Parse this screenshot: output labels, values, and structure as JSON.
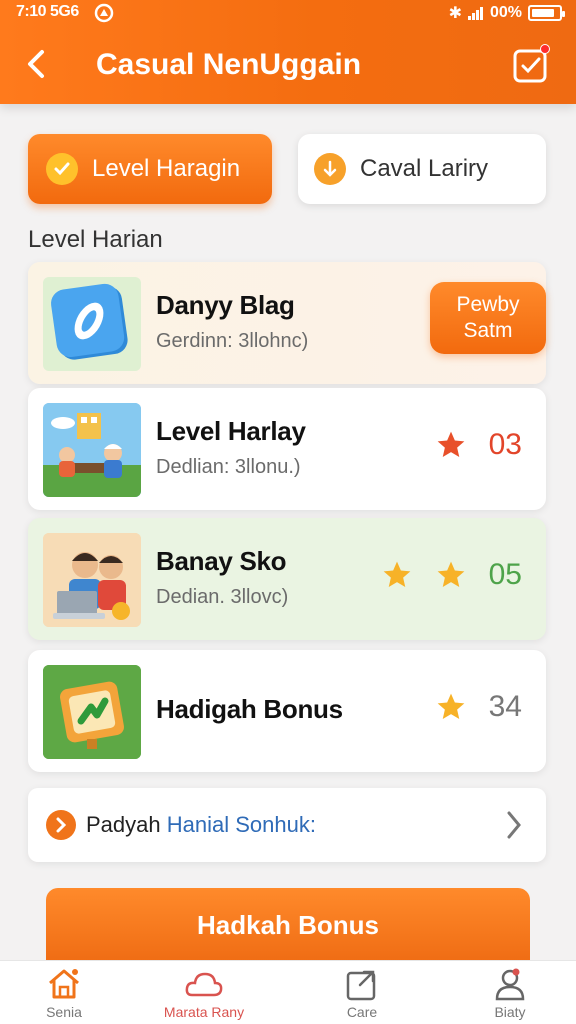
{
  "status_bar": {
    "time": "7:10 5G6",
    "battery_text": "00%"
  },
  "header": {
    "title": "Casual NenUggain"
  },
  "tabs": [
    {
      "label": "Level Haragin",
      "active": true
    },
    {
      "label": "Caval Lariry",
      "active": false
    }
  ],
  "section": {
    "title": "Level Harian"
  },
  "cards": [
    {
      "title": "Danyy Blag",
      "subtitle": "Gerdinn: 3llohnc)",
      "button": "Pewby Satm",
      "icon": "app-o-icon"
    },
    {
      "title": "Level Harlay",
      "subtitle": "Dedlian: 3llonu.)",
      "score": "03",
      "icon": "family-picnic-image"
    },
    {
      "title": "Banay Sko",
      "subtitle": "Dedian. 3llovc)",
      "score": "05",
      "icon": "family-laptop-image"
    },
    {
      "title": "Hadigah Bonus",
      "score": "34",
      "icon": "bonus-box-icon"
    }
  ],
  "bonus_link": {
    "text_a": "Padyah",
    "text_b": "Hanial Sonhuk:"
  },
  "cta": {
    "label": "Hadkah Bonus"
  },
  "bottom_nav": [
    {
      "label": "Senia",
      "icon": "home-icon"
    },
    {
      "label": "Marata Rany",
      "icon": "cloud-icon"
    },
    {
      "label": "Care",
      "icon": "share-icon"
    },
    {
      "label": "Biaty",
      "icon": "user-icon"
    }
  ],
  "colors": {
    "accent": "#F26A0E",
    "header": "#FF7A1C",
    "peach_card": "#FBF3E4",
    "green_card": "#EAF4E2"
  }
}
